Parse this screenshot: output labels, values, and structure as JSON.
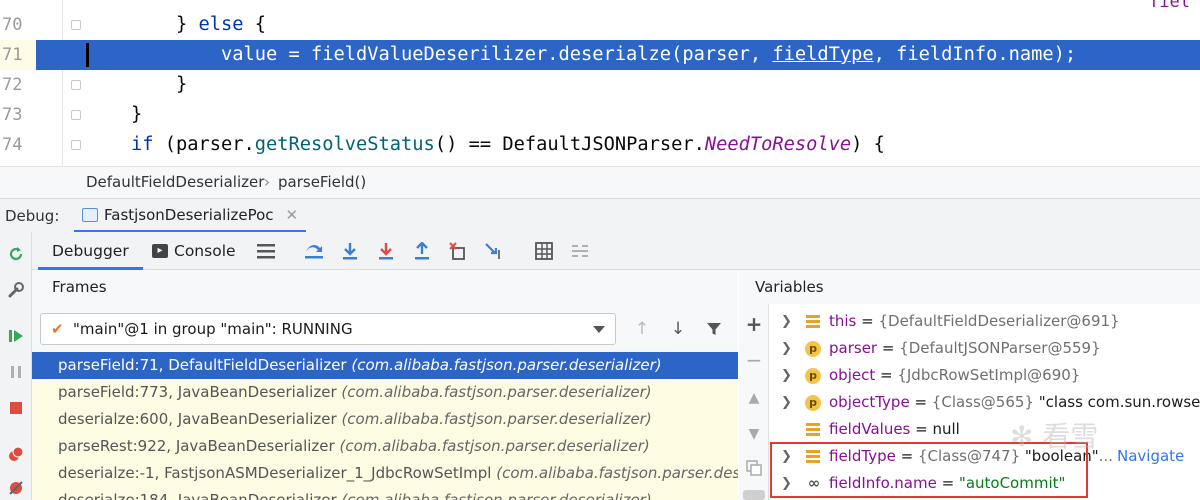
{
  "editor": {
    "top_clip_text": "fiel",
    "lines": [
      {
        "num": "70",
        "kind": "else",
        "indent": "        ",
        "close": "} ",
        "kw": "else",
        "open": " {"
      },
      {
        "num": "71",
        "kind": "assign",
        "indent": "            ",
        "lhs": "value = fieldValueDeserilizer.",
        "method": "deserialze",
        "args_start": "(parser, ",
        "arg_ul": "fieldType",
        "args_end": ", fieldInfo.name);"
      },
      {
        "num": "72",
        "kind": "brace",
        "indent": "        ",
        "text": "}"
      },
      {
        "num": "73",
        "kind": "brace",
        "indent": "    ",
        "text": "}"
      },
      {
        "num": "74",
        "kind": "if",
        "indent": "    ",
        "kw": "if",
        "open_paren": " (parser.",
        "method": "getResolveStatus",
        "middle": "() == DefaultJSONParser.",
        "static": "NeedToResolve",
        "end": ") {"
      }
    ]
  },
  "breadcrumb": {
    "class_name": "DefaultFieldDeserializer",
    "sep": "›",
    "method": "parseField()"
  },
  "debug": {
    "label": "Debug:",
    "run_config": "FastjsonDeserializePoc",
    "close": "✕"
  },
  "toolbar": {
    "debugger_tab": "Debugger",
    "console_tab": "Console"
  },
  "frames": {
    "header": "Frames",
    "thread": "\"main\"@1 in group \"main\": RUNNING",
    "items": [
      {
        "method": "parseField:71, DefaultFieldDeserializer",
        "pkg": "(com.alibaba.fastjson.parser.deserializer)"
      },
      {
        "method": "parseField:773, JavaBeanDeserializer",
        "pkg": "(com.alibaba.fastjson.parser.deserializer)"
      },
      {
        "method": "deserialze:600, JavaBeanDeserializer",
        "pkg": "(com.alibaba.fastjson.parser.deserializer)"
      },
      {
        "method": "parseRest:922, JavaBeanDeserializer",
        "pkg": "(com.alibaba.fastjson.parser.deserializer)"
      },
      {
        "method": "deserialze:-1, FastjsonASMDeserializer_1_JdbcRowSetImpl",
        "pkg": "(com.alibaba.fastjson.parser.deserialize"
      },
      {
        "method": "deserialze:184, JavaBeanDeserializer",
        "pkg": "(com.alibaba.fastjson.parser.deserializer)"
      }
    ]
  },
  "variables": {
    "header": "Variables",
    "items": [
      {
        "icon": "field",
        "name": "this",
        "eq": " = ",
        "gray": "{DefaultFieldDeserializer@691}",
        "extra": ""
      },
      {
        "icon": "p",
        "name": "parser",
        "eq": " = ",
        "gray": "{DefaultJSONParser@559}",
        "extra": ""
      },
      {
        "icon": "p",
        "name": "object",
        "eq": " = ",
        "gray": "{JdbcRowSetImpl@690}",
        "extra": ""
      },
      {
        "icon": "p",
        "name": "objectType",
        "eq": " = ",
        "gray": "{Class@565}",
        "extra": " \"class com.sun.rowset.Jdbc"
      },
      {
        "icon": "field",
        "name": "fieldValues",
        "eq": " = ",
        "gray": "",
        "extra": "null"
      },
      {
        "icon": "field",
        "name": "fieldType",
        "eq": " = ",
        "gray": "{Class@747}",
        "extra": " \"boolean\"",
        "ellipsis": "...",
        "link": "Navigate"
      },
      {
        "icon": "watch",
        "name": "fieldInfo.name",
        "eq": " = ",
        "gray": "",
        "str": "\"autoCommit\""
      }
    ]
  },
  "watermark": "✻ 看雪"
}
